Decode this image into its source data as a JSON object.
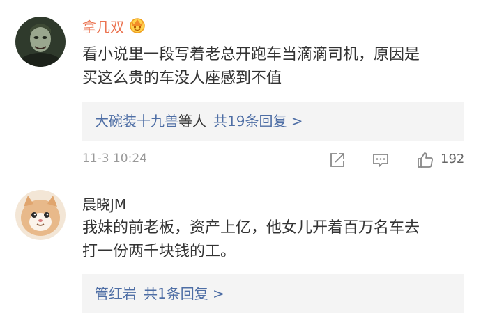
{
  "comments": [
    {
      "username": "拿几双",
      "text": "看小说里一段写着老总开跑车当滴滴司机，原因是\n买这么贵的车没人座感到不值",
      "replies": {
        "names": "大碗装十九兽",
        "suffix": "等人",
        "count": "共19条回复 >"
      },
      "time": "11-3 10:24",
      "likes": "192",
      "badge_icon": "vip-crown-badge-icon"
    },
    {
      "username": "晨晓JM",
      "text": "我妹的前老板，资产上亿，他女儿开着百万名车去\n打一份两千块钱的工。",
      "replies": {
        "names": "管红岩",
        "suffix": "",
        "count": "共1条回复 >"
      }
    }
  ],
  "colors": {
    "username_highlight": "#eb7350",
    "link_blue": "#4e6ea5",
    "reply_bg": "#f4f4f4",
    "meta_gray": "#999999"
  },
  "icons": [
    "share-icon",
    "comment-icon",
    "like-icon"
  ]
}
